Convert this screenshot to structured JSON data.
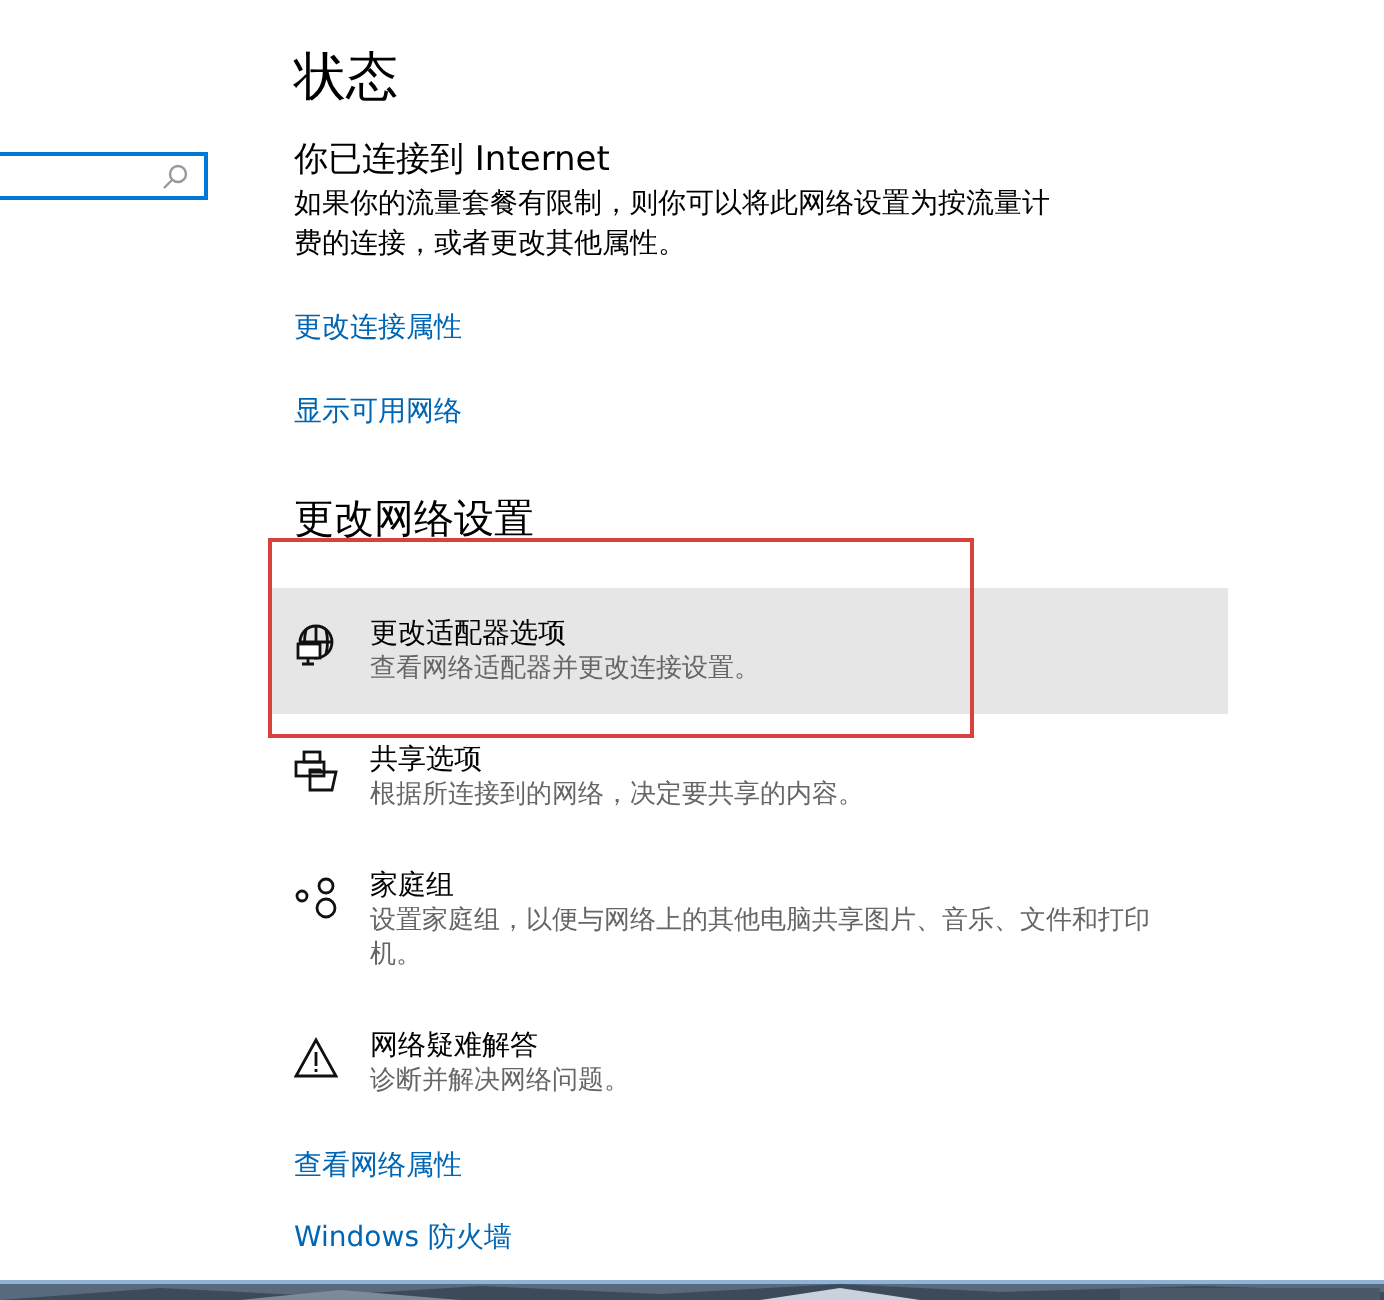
{
  "search": {
    "kind": "search"
  },
  "page_title": "状态",
  "status": {
    "heading": "你已连接到 Internet",
    "description": "如果你的流量套餐有限制，则你可以将此网络设置为按流量计费的连接，或者更改其他属性。"
  },
  "status_links": [
    "更改连接属性",
    "显示可用网络"
  ],
  "section_heading": "更改网络设置",
  "items": [
    {
      "kind": "adapter",
      "title": "更改适配器选项",
      "description": "查看网络适配器并更改连接设置。",
      "highlighted": true,
      "framed": true
    },
    {
      "kind": "sharing",
      "title": "共享选项",
      "description": "根据所连接到的网络，决定要共享的内容。",
      "highlighted": false,
      "framed": false
    },
    {
      "kind": "homegroup",
      "title": "家庭组",
      "description": "设置家庭组，以便与网络上的其他电脑共享图片、音乐、文件和打印机。",
      "highlighted": false,
      "framed": false
    },
    {
      "kind": "troubleshoot",
      "title": "网络疑难解答",
      "description": "诊断并解决网络问题。",
      "highlighted": false,
      "framed": false
    }
  ],
  "bottom_links": [
    "查看网络属性",
    "Windows 防火墙"
  ]
}
